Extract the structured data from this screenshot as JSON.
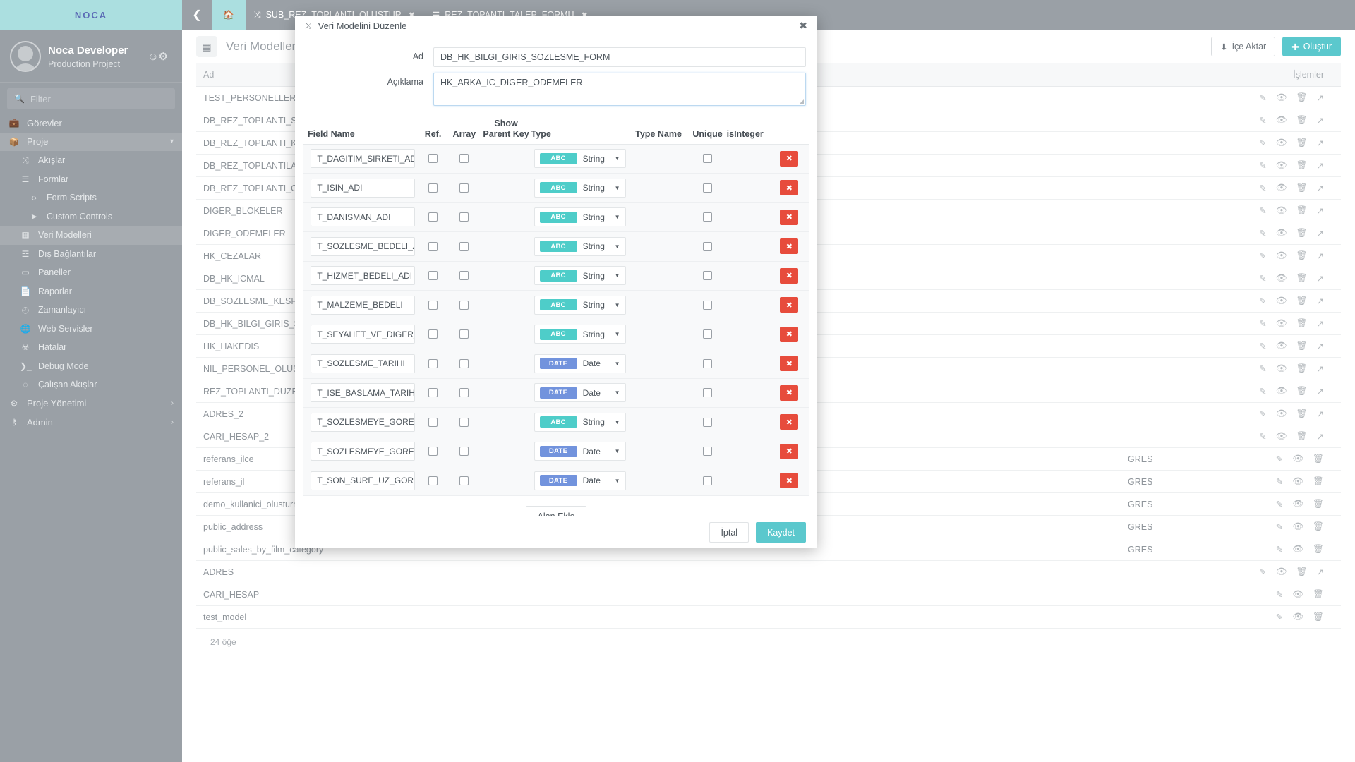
{
  "brand": {
    "logo_text": "NOCA"
  },
  "sidebar": {
    "profile": {
      "name": "Noca Developer",
      "project": "Production Project",
      "action_icon": "user-settings-icon"
    },
    "filter": {
      "placeholder": "Filter",
      "icon": "search-icon"
    },
    "items": [
      {
        "label": "Görevler",
        "icon": "briefcase-icon",
        "level": 0,
        "active": false
      },
      {
        "label": "Proje",
        "icon": "box-icon",
        "level": 0,
        "active": true,
        "chevron": "▾"
      },
      {
        "label": "Akışlar",
        "icon": "shuffle-icon",
        "level": 1,
        "active": false
      },
      {
        "label": "Formlar",
        "icon": "form-icon",
        "level": 1,
        "active": false
      },
      {
        "label": "Form Scripts",
        "icon": "code-icon",
        "level": 2,
        "active": false
      },
      {
        "label": "Custom Controls",
        "icon": "cursor-icon",
        "level": 2,
        "active": false
      },
      {
        "label": "Veri Modelleri",
        "icon": "grid-icon",
        "level": 1,
        "active": true
      },
      {
        "label": "Dış Bağlantılar",
        "icon": "database-icon",
        "level": 1,
        "active": false
      },
      {
        "label": "Paneller",
        "icon": "panel-icon",
        "level": 1,
        "active": false
      },
      {
        "label": "Raporlar",
        "icon": "report-icon",
        "level": 1,
        "active": false
      },
      {
        "label": "Zamanlayıcı",
        "icon": "clock-icon",
        "level": 1,
        "active": false
      },
      {
        "label": "Web Servisler",
        "icon": "globe-icon",
        "level": 1,
        "active": false
      },
      {
        "label": "Hatalar",
        "icon": "bug-icon",
        "level": 1,
        "active": false
      },
      {
        "label": "Debug Mode",
        "icon": "terminal-icon",
        "level": 1,
        "active": false
      },
      {
        "label": "Çalışan Akışlar",
        "icon": "spinner-icon",
        "level": 1,
        "active": false
      },
      {
        "label": "Proje Yönetimi",
        "icon": "gears-icon",
        "level": 0,
        "active": false,
        "chevron": "›"
      },
      {
        "label": "Admin",
        "icon": "key-icon",
        "level": 0,
        "active": false,
        "chevron": "›"
      }
    ]
  },
  "topbar": {
    "back_icon": "chevron-left-icon",
    "tabs": [
      {
        "label": "",
        "icon": "home-icon",
        "closable": false,
        "active": true
      },
      {
        "label": "SUB_REZ_TOPLANTI_OLUSTUR",
        "icon": "shuffle-icon",
        "closable": true,
        "active": false
      },
      {
        "label": "REZ_TOPANTI_TALEP_FORMU",
        "icon": "form-icon",
        "closable": true,
        "active": false
      }
    ]
  },
  "content_header": {
    "icon": "grid-icon",
    "title": "Veri Modelleri",
    "search_placeholder": "Veri Modelleri",
    "import_label": "İçe Aktar",
    "import_icon": "download-icon",
    "create_label": "Oluştur",
    "create_icon": "plus-icon",
    "accent_color": "#5bc8cd"
  },
  "main_table": {
    "columns": [
      "Ad",
      "",
      "İşlemler"
    ],
    "row_action_icons": [
      "edit-icon",
      "eye-icon",
      "trash-icon",
      "external-link-icon"
    ],
    "rows": [
      {
        "name": "TEST_PERSONELLER",
        "desc": "",
        "actions": 4
      },
      {
        "name": "DB_REZ_TOPLANTI_SAATLERI",
        "desc": "",
        "actions": 4
      },
      {
        "name": "DB_REZ_TOPLANTI_KATILIMCILARI",
        "desc": "",
        "actions": 4
      },
      {
        "name": "DB_REZ_TOPLANTILAR",
        "desc": "",
        "actions": 4
      },
      {
        "name": "DB_REZ_TOPLANTI_OLUSTUR",
        "desc": "",
        "actions": 4
      },
      {
        "name": "DIGER_BLOKELER",
        "desc": "",
        "actions": 4
      },
      {
        "name": "DIGER_ODEMELER",
        "desc": "",
        "actions": 4
      },
      {
        "name": "HK_CEZALAR",
        "desc": "",
        "actions": 4
      },
      {
        "name": "DB_HK_ICMAL",
        "desc": "",
        "actions": 4
      },
      {
        "name": "DB_SOZLESME_KESFI_BIRIM_FIYATLARI",
        "desc": "",
        "actions": 4
      },
      {
        "name": "DB_HK_BILGI_GIRIS_SOZLESME_FORM",
        "desc": "",
        "actions": 4
      },
      {
        "name": "HK_HAKEDIS",
        "desc": "",
        "actions": 4
      },
      {
        "name": "NIL_PERSONEL_OLUSTUR_MODEL",
        "desc": "",
        "actions": 4
      },
      {
        "name": "REZ_TOPLANTI_DUZENLEYEN_PERSON",
        "desc": "",
        "actions": 4
      },
      {
        "name": "ADRES_2",
        "desc": "",
        "actions": 4
      },
      {
        "name": "CARI_HESAP_2",
        "desc": "",
        "actions": 4
      },
      {
        "name": "referans_ilce",
        "desc": "GRES",
        "actions": 3
      },
      {
        "name": "referans_il",
        "desc": "GRES",
        "actions": 3
      },
      {
        "name": "demo_kullanici_olusturma_talep",
        "desc": "GRES",
        "actions": 3
      },
      {
        "name": "public_address",
        "desc": "GRES",
        "actions": 3
      },
      {
        "name": "public_sales_by_film_category",
        "desc": "GRES",
        "actions": 3
      },
      {
        "name": "ADRES",
        "desc": "",
        "actions": 4
      },
      {
        "name": "CARI_HESAP",
        "desc": "",
        "actions": 3
      },
      {
        "name": "test_model",
        "desc": "",
        "actions": 3
      }
    ],
    "footer_count": "24 öğe"
  },
  "modal": {
    "title": "Veri Modelini Düzenle",
    "title_icon": "shuffle-icon",
    "close_icon": "close-icon",
    "form": {
      "name_label": "Ad",
      "name_value": "DB_HK_BILGI_GIRIS_SOZLESME_FORM",
      "desc_label": "Açıklama",
      "desc_value": "HK_ARKA_IC_DIGER_ODEMELER"
    },
    "table_headers": {
      "field_name": "Field Name",
      "ref": "Ref.",
      "array": "Array",
      "show_parent_key": "Show Parent Key",
      "type": "Type",
      "type_name": "Type Name",
      "unique": "Unique",
      "is_integer": "isInteger"
    },
    "type_colors": {
      "String": "#4ecdc9",
      "Date": "#7293dd"
    },
    "rows": [
      {
        "field_name": "T_DAGITIM_SIRKETI_ADI",
        "ref": false,
        "array": false,
        "show_parent_key": "",
        "type": "String",
        "type_badge": "ABC",
        "type_name": "",
        "unique": false,
        "is_integer": ""
      },
      {
        "field_name": "T_ISIN_ADI",
        "ref": false,
        "array": false,
        "show_parent_key": "",
        "type": "String",
        "type_badge": "ABC",
        "type_name": "",
        "unique": false,
        "is_integer": ""
      },
      {
        "field_name": "T_DANISMAN_ADI",
        "ref": false,
        "array": false,
        "show_parent_key": "",
        "type": "String",
        "type_badge": "ABC",
        "type_name": "",
        "unique": false,
        "is_integer": ""
      },
      {
        "field_name": "T_SOZLESME_BEDELI_ADI",
        "ref": false,
        "array": false,
        "show_parent_key": "",
        "type": "String",
        "type_badge": "ABC",
        "type_name": "",
        "unique": false,
        "is_integer": ""
      },
      {
        "field_name": "T_HIZMET_BEDELI_ADI",
        "ref": false,
        "array": false,
        "show_parent_key": "",
        "type": "String",
        "type_badge": "ABC",
        "type_name": "",
        "unique": false,
        "is_integer": ""
      },
      {
        "field_name": "T_MALZEME_BEDELI",
        "ref": false,
        "array": false,
        "show_parent_key": "",
        "type": "String",
        "type_badge": "ABC",
        "type_name": "",
        "unique": false,
        "is_integer": ""
      },
      {
        "field_name": "T_SEYAHET_VE_DIGER_ODEME",
        "ref": false,
        "array": false,
        "show_parent_key": "",
        "type": "String",
        "type_badge": "ABC",
        "type_name": "",
        "unique": false,
        "is_integer": ""
      },
      {
        "field_name": "T_SOZLESME_TARIHI",
        "ref": false,
        "array": false,
        "show_parent_key": "",
        "type": "Date",
        "type_badge": "DATE",
        "type_name": "",
        "unique": false,
        "is_integer": ""
      },
      {
        "field_name": "T_ISE_BASLAMA_TARIHI",
        "ref": false,
        "array": false,
        "show_parent_key": "",
        "type": "Date",
        "type_badge": "DATE",
        "type_name": "",
        "unique": false,
        "is_integer": ""
      },
      {
        "field_name": "T_SOZLESMEYE_GORE_ISIN_SURESI",
        "ref": false,
        "array": false,
        "show_parent_key": "",
        "type": "String",
        "type_badge": "ABC",
        "type_name": "",
        "unique": false,
        "is_integer": ""
      },
      {
        "field_name": "T_SOZLESMEYE_GORE_ISIN_BITIS",
        "ref": false,
        "array": false,
        "show_parent_key": "",
        "type": "Date",
        "type_badge": "DATE",
        "type_name": "",
        "unique": false,
        "is_integer": ""
      },
      {
        "field_name": "T_SON_SURE_UZ_GORE_BITIS",
        "ref": false,
        "array": false,
        "show_parent_key": "",
        "type": "Date",
        "type_badge": "DATE",
        "type_name": "",
        "unique": false,
        "is_integer": ""
      }
    ],
    "delete_icon": "close-icon",
    "add_field_label": "Alan Ekle",
    "cancel_label": "İptal",
    "save_label": "Kaydet",
    "save_color": "#5bc8cd"
  }
}
